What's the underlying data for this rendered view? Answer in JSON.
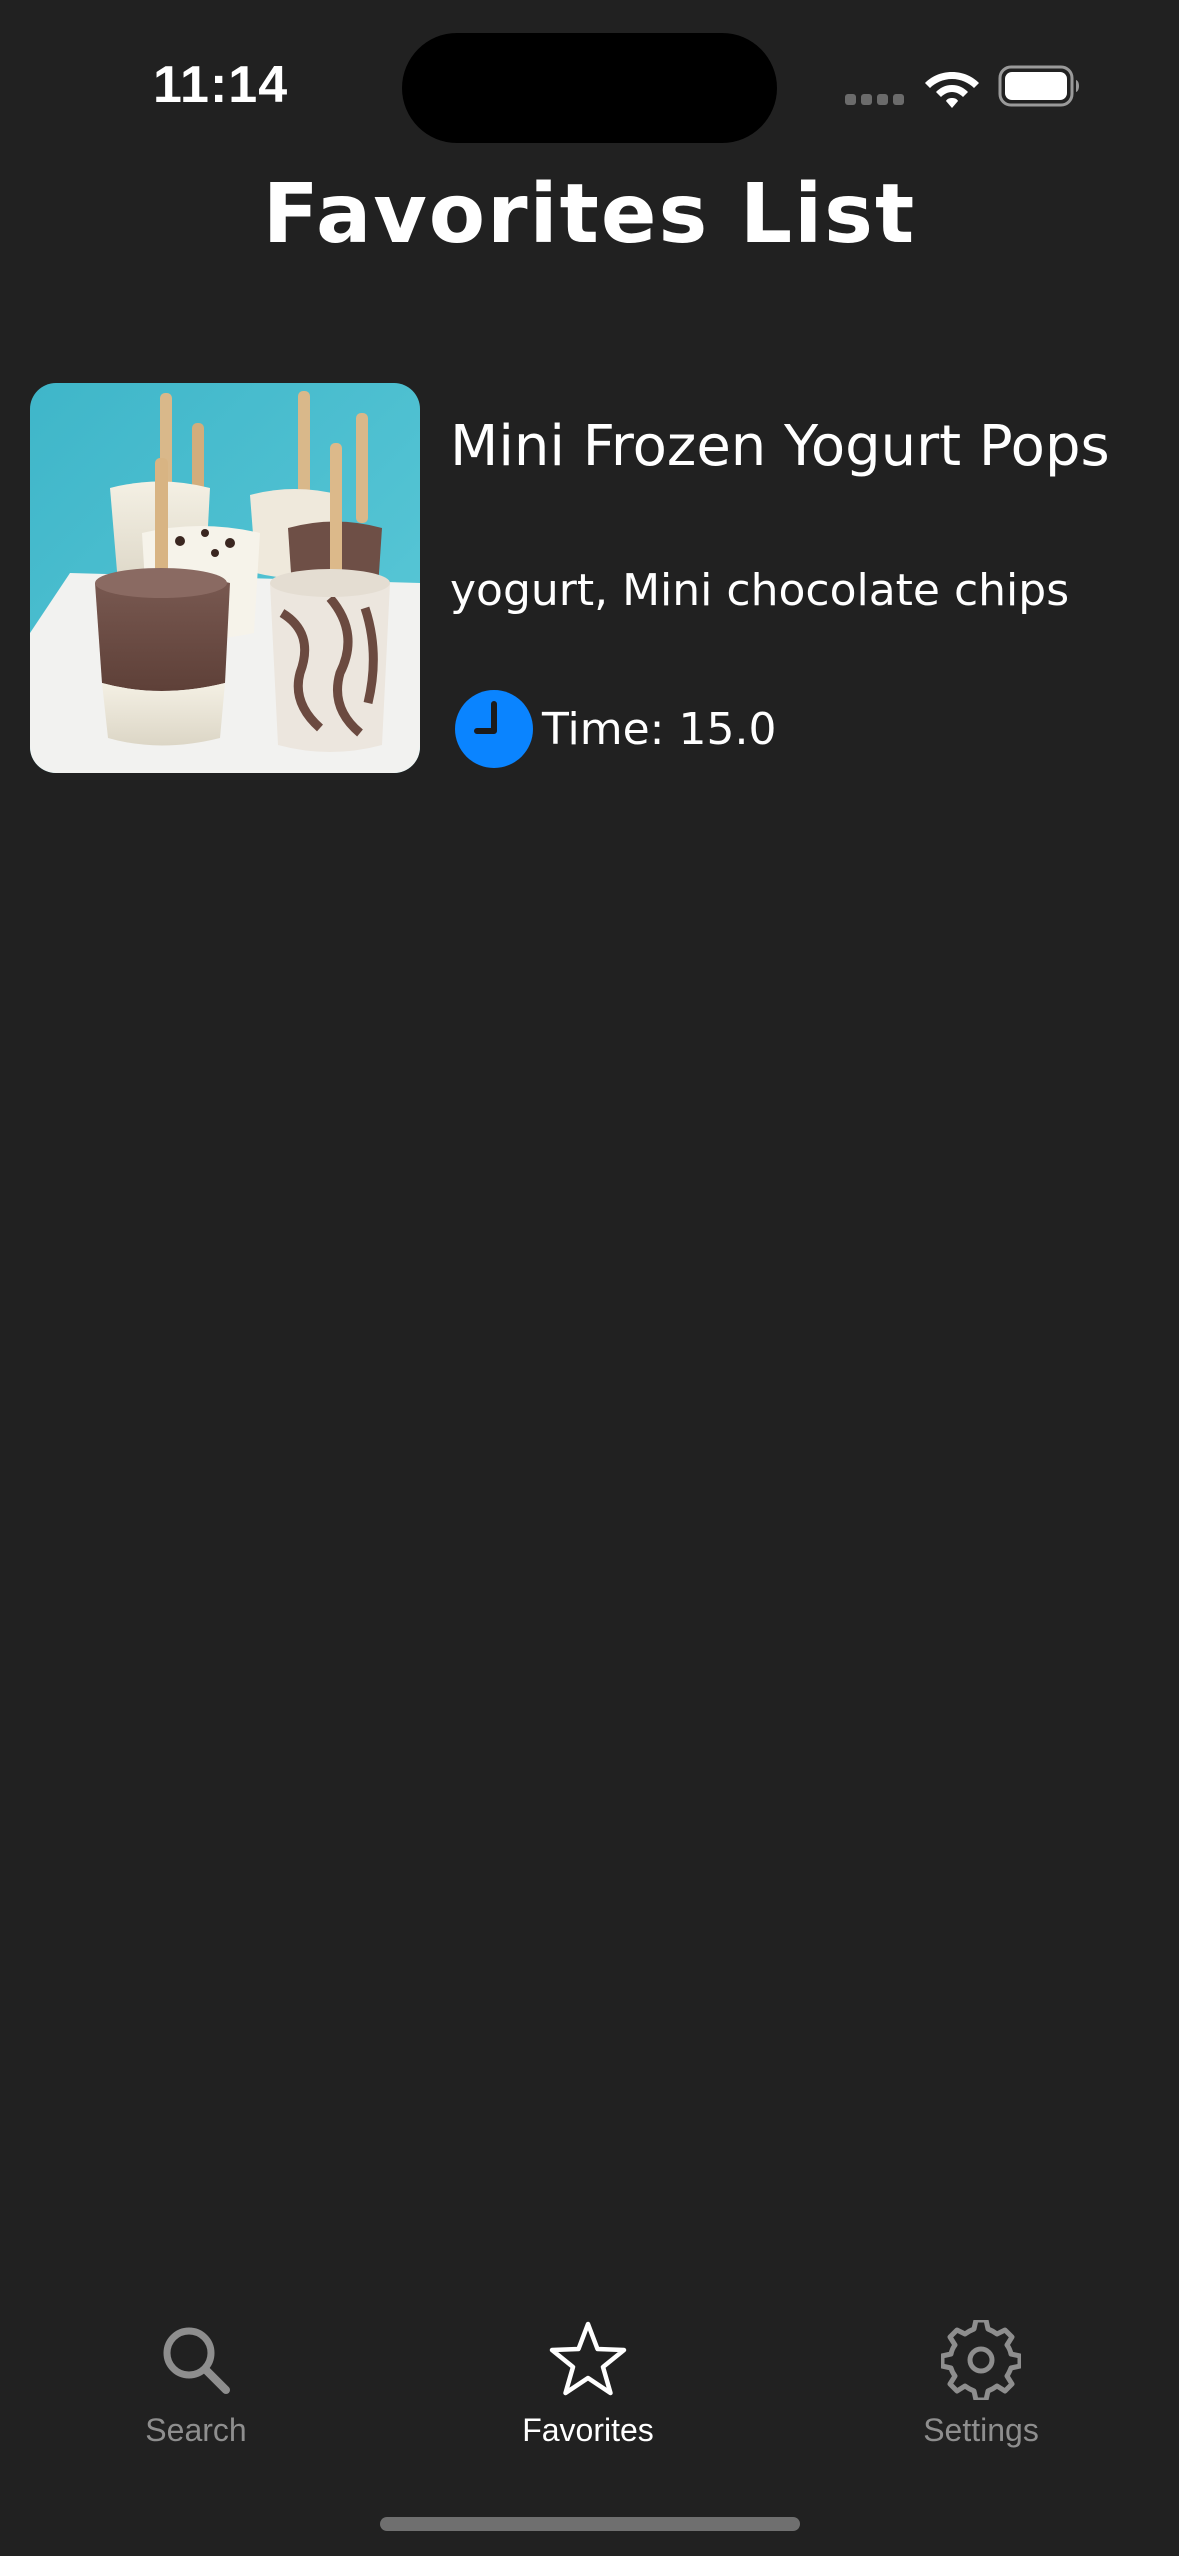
{
  "status_bar": {
    "time": "11:14"
  },
  "header": {
    "title": "Favorites List"
  },
  "favorites": [
    {
      "title": "Mini Frozen Yogurt Pops",
      "ingredients": "yogurt, Mini chocolate chips",
      "time_label": "Time: 15.0",
      "thumbnail": "frozen-yogurt-pops-photo"
    }
  ],
  "tab_bar": {
    "tabs": [
      {
        "label": "Search",
        "icon": "search-icon",
        "selected": false
      },
      {
        "label": "Favorites",
        "icon": "star-icon",
        "selected": true
      },
      {
        "label": "Settings",
        "icon": "gear-icon",
        "selected": false
      }
    ]
  },
  "colors": {
    "background": "#212121",
    "accent": "#0a84ff",
    "tab_inactive": "#8e8e8e",
    "tab_active": "#ffffff"
  }
}
